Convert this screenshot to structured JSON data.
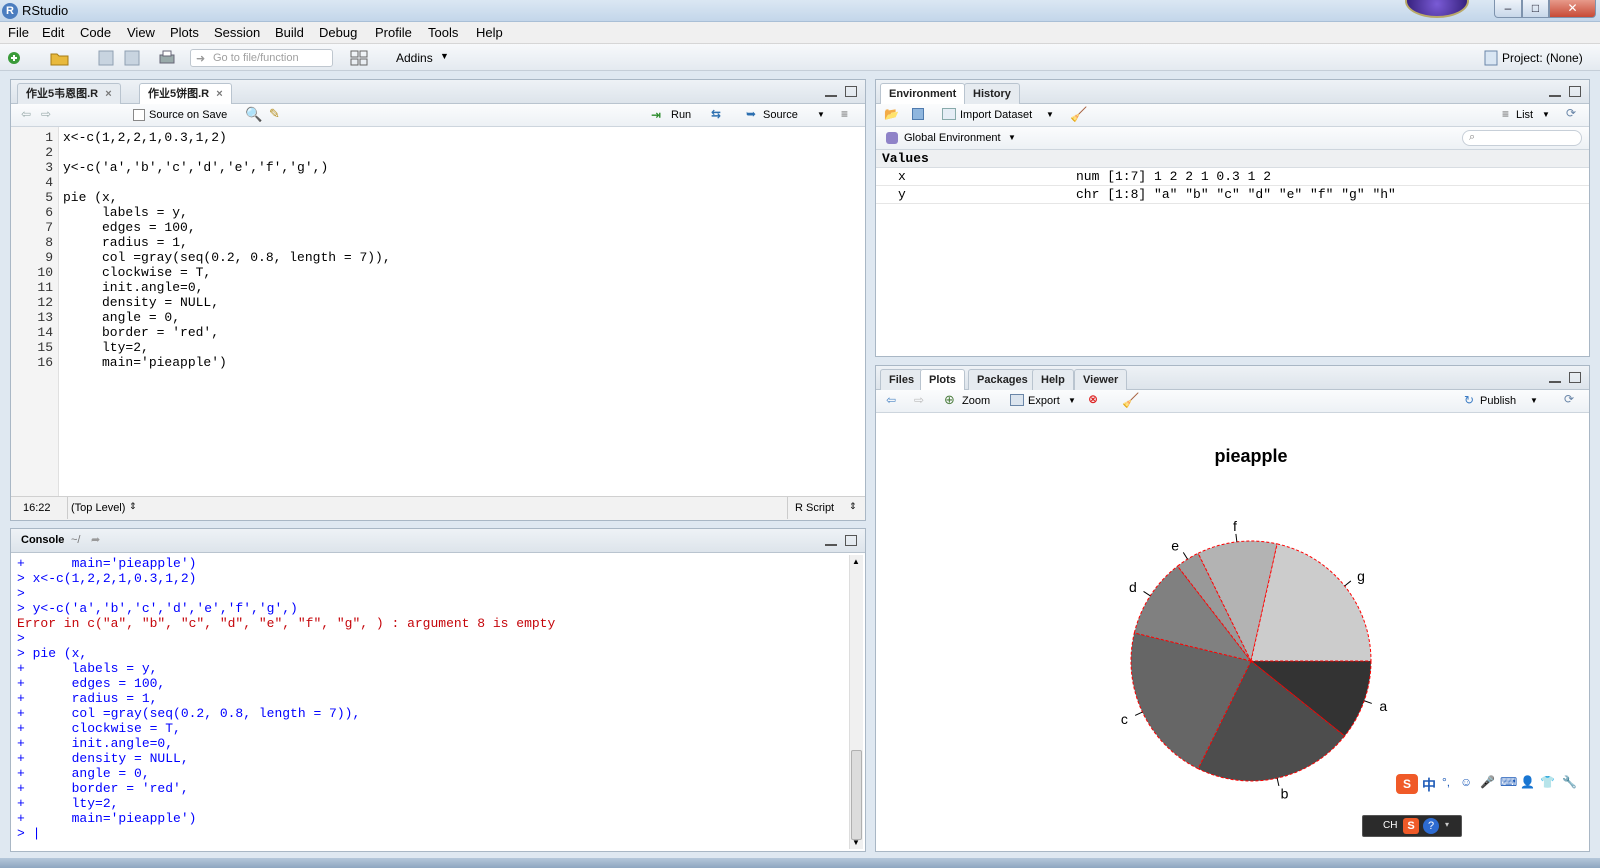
{
  "window": {
    "title": "RStudio"
  },
  "menu": [
    "File",
    "Edit",
    "Code",
    "View",
    "Plots",
    "Session",
    "Build",
    "Debug",
    "Profile",
    "Tools",
    "Help"
  ],
  "toolbar": {
    "goto_placeholder": "Go to file/function",
    "addins": "Addins",
    "project": "Project: (None)"
  },
  "editor": {
    "tabs": [
      "作业5韦恩图.R",
      "作业5饼图.R"
    ],
    "source_on_save": "Source on Save",
    "run": "Run",
    "source": "Source",
    "lines": [
      "x<-c(1,2,2,1,0.3,1,2)",
      "",
      "y<-c('a','b','c','d','e','f','g',)",
      "",
      "pie (x,",
      "     labels = y,",
      "     edges = 100,",
      "     radius = 1,",
      "     col =gray(seq(0.2, 0.8, length = 7)),",
      "     clockwise = T,",
      "     init.angle=0,",
      "     density = NULL,",
      "     angle = 0,",
      "     border = 'red',",
      "     lty=2,",
      "     main='pieapple')"
    ],
    "line_numbers": [
      "1",
      "2",
      "3",
      "4",
      "5",
      "6",
      "7",
      "8",
      "9",
      "10",
      "11",
      "12",
      "13",
      "14",
      "15",
      "16"
    ],
    "cursor_pos": "16:22",
    "scope": "(Top Level)",
    "file_type": "R Script"
  },
  "console": {
    "title": "Console",
    "path": "~/",
    "lines": [
      {
        "text": "+      main='pieapple')",
        "err": false
      },
      {
        "text": "> x<-c(1,2,2,1,0.3,1,2)",
        "err": false
      },
      {
        "text": ">",
        "err": false
      },
      {
        "text": "> y<-c('a','b','c','d','e','f','g',)",
        "err": false
      },
      {
        "text": "Error in c(\"a\", \"b\", \"c\", \"d\", \"e\", \"f\", \"g\", ) : argument 8 is empty",
        "err": true
      },
      {
        "text": ">",
        "err": false
      },
      {
        "text": "> pie (x,",
        "err": false
      },
      {
        "text": "+      labels = y,",
        "err": false
      },
      {
        "text": "+      edges = 100,",
        "err": false
      },
      {
        "text": "+      radius = 1,",
        "err": false
      },
      {
        "text": "+      col =gray(seq(0.2, 0.8, length = 7)),",
        "err": false
      },
      {
        "text": "+      clockwise = T,",
        "err": false
      },
      {
        "text": "+      init.angle=0,",
        "err": false
      },
      {
        "text": "+      density = NULL,",
        "err": false
      },
      {
        "text": "+      angle = 0,",
        "err": false
      },
      {
        "text": "+      border = 'red',",
        "err": false
      },
      {
        "text": "+      lty=2,",
        "err": false
      },
      {
        "text": "+      main='pieapple')",
        "err": false
      },
      {
        "text": "> |",
        "err": false
      }
    ]
  },
  "environment": {
    "tabs": [
      "Environment",
      "History"
    ],
    "import_dataset": "Import Dataset",
    "list_view": "List",
    "scope": "Global Environment",
    "section": "Values",
    "rows": [
      {
        "name": "x",
        "value": "num [1:7] 1 2 2 1 0.3 1 2"
      },
      {
        "name": "y",
        "value": "chr [1:8] \"a\" \"b\" \"c\" \"d\" \"e\" \"f\" \"g\" \"h\""
      }
    ]
  },
  "files_pane": {
    "tabs": [
      "Files",
      "Plots",
      "Packages",
      "Help",
      "Viewer"
    ],
    "zoom": "Zoom",
    "export": "Export",
    "publish": "Publish"
  },
  "chart_data": {
    "type": "pie",
    "title": "pieapple",
    "categories": [
      "a",
      "b",
      "c",
      "d",
      "e",
      "f",
      "g"
    ],
    "values": [
      1,
      2,
      2,
      1,
      0.3,
      1,
      2
    ],
    "colors": [
      "#333333",
      "#4d4d4d",
      "#666666",
      "#808080",
      "#999999",
      "#b3b3b3",
      "#cccccc"
    ],
    "clockwise": true,
    "border_color": "#ff0000",
    "border_style": "dashed"
  },
  "ime": {
    "label": "CH"
  }
}
